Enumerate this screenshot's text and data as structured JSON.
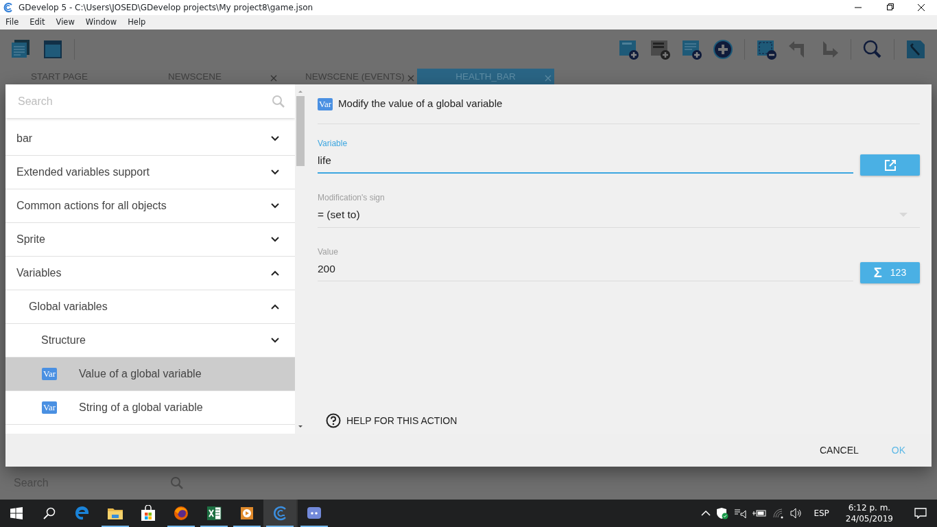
{
  "window": {
    "title": "GDevelop 5 - C:\\Users\\JOSED\\GDevelop projects\\My project8\\game.json"
  },
  "menu": [
    "File",
    "Edit",
    "View",
    "Window",
    "Help"
  ],
  "toolbar": {
    "left": [
      {
        "kind": "project"
      },
      {
        "kind": "scene"
      }
    ],
    "right": [
      {
        "kind": "add-scene"
      },
      {
        "kind": "add-object"
      },
      {
        "kind": "add-event"
      },
      {
        "kind": "add"
      },
      {
        "kind": "separator"
      },
      {
        "kind": "remove"
      },
      {
        "kind": "undo"
      },
      {
        "kind": "redo"
      },
      {
        "kind": "separator"
      },
      {
        "kind": "search"
      },
      {
        "kind": "separator"
      },
      {
        "kind": "settings"
      }
    ]
  },
  "tabs": [
    {
      "label": "START PAGE",
      "closable": false,
      "selected": false
    },
    {
      "label": "NEWSCENE",
      "closable": true,
      "selected": false
    },
    {
      "label": "NEWSCENE (EVENTS)",
      "closable": true,
      "selected": false
    },
    {
      "label": "HEALTH_BAR",
      "closable": true,
      "selected": true
    }
  ],
  "dialog": {
    "search": {
      "placeholder": "Search"
    },
    "tree": [
      {
        "label": "bar",
        "expanded": false
      },
      {
        "label": "Extended variables support",
        "expanded": false
      },
      {
        "label": "Common actions for all objects",
        "expanded": false
      },
      {
        "label": "Sprite",
        "expanded": false
      },
      {
        "label": "Variables",
        "expanded": true,
        "children": [
          {
            "label": "Global variables",
            "expanded": true,
            "children": [
              {
                "label": "Structure",
                "expanded": false
              },
              {
                "kind": "action",
                "icon": "Var",
                "label": "Value of a global variable",
                "selected": true
              },
              {
                "kind": "action",
                "icon": "Var",
                "label": "String of a global variable",
                "selected": false
              }
            ]
          }
        ]
      }
    ],
    "header": {
      "icon": "Var",
      "title": "Modify the value of a global variable"
    },
    "fields": [
      {
        "kind": "text",
        "label": "Variable",
        "value": "life",
        "focused": true,
        "button": {
          "kind": "open"
        }
      },
      {
        "kind": "select",
        "label": "Modification's sign",
        "value": "= (set to)",
        "focused": false
      },
      {
        "kind": "text",
        "label": "Value",
        "value": "200",
        "focused": false,
        "button": {
          "kind": "expression",
          "symbol": "Σ",
          "label": "123"
        }
      }
    ],
    "help": "HELP FOR THIS ACTION",
    "buttons": [
      {
        "label": "CANCEL",
        "primary": false
      },
      {
        "label": "OK",
        "primary": true
      }
    ]
  },
  "background_search": {
    "placeholder": "Search"
  },
  "taskbar": {
    "apps": [
      {
        "kind": "edge",
        "running": false,
        "active": false
      },
      {
        "kind": "folder",
        "running": true,
        "active": false
      },
      {
        "kind": "store",
        "running": false,
        "active": false
      },
      {
        "kind": "firefox",
        "running": true,
        "active": false
      },
      {
        "kind": "excel",
        "running": true,
        "active": false
      },
      {
        "kind": "media",
        "running": true,
        "active": false
      },
      {
        "kind": "gdevelop",
        "running": true,
        "active": true
      },
      {
        "kind": "discord",
        "running": true,
        "active": false
      }
    ],
    "language": "ESP",
    "time": "6:12 p. m.",
    "date": "24/05/2019"
  }
}
